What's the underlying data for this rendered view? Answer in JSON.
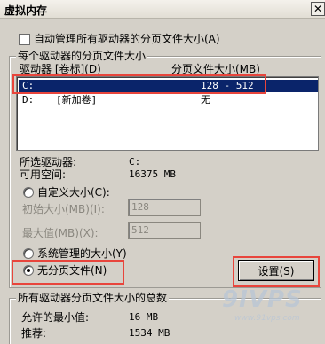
{
  "window": {
    "title": "虚拟内存",
    "close_glyph": "✕"
  },
  "auto_manage": {
    "label": "自动管理所有驱动器的分页文件大小(A)",
    "checked": false
  },
  "drives_group": {
    "title": "每个驱动器的分页文件大小",
    "col_drive": "驱动器 [卷标](D)",
    "col_size": "分页文件大小(MB)",
    "rows": [
      {
        "drive": "C:",
        "label": "",
        "size": "128 - 512",
        "selected": true
      },
      {
        "drive": "D:",
        "label": "[新加卷]",
        "size": "无",
        "selected": false
      }
    ],
    "selected_drive_label": "所选驱动器:",
    "selected_drive_value": "C:",
    "free_space_label": "可用空间:",
    "free_space_value": "16375 MB",
    "custom_size": {
      "label": "自定义大小(C):",
      "selected": false
    },
    "initial_size": {
      "label": "初始大小(MB)(I):",
      "value": "128"
    },
    "max_size": {
      "label": "最大值(MB)(X):",
      "value": "512"
    },
    "system_managed": {
      "label": "系统管理的大小(Y)",
      "selected": false
    },
    "no_paging": {
      "label": "无分页文件(N)",
      "selected": true
    },
    "set_button": "设置(S)"
  },
  "totals_group": {
    "title": "所有驱动器分页文件大小的总数",
    "min_label": "允许的最小值:",
    "min_value": "16 MB",
    "recommended_label": "推荐:",
    "recommended_value": "1534 MB"
  },
  "watermark": {
    "brand": "9IVPS",
    "url": "www.91vps.com"
  },
  "colors": {
    "highlight": "#e8453c",
    "selection": "#0a246a",
    "face": "#d4d0c8"
  }
}
